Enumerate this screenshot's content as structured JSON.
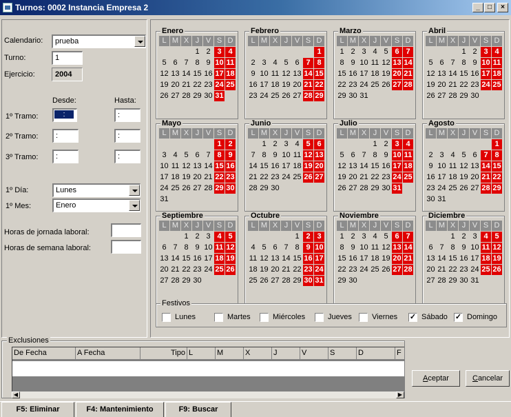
{
  "window": {
    "title": "Turnos: 0002 Instancia Empresa 2",
    "minimize": "_",
    "maximize": "□",
    "close": "×"
  },
  "form": {
    "calendario_label": "Calendario:",
    "calendario_value": "prueba",
    "turno_label": "Turno:",
    "turno_value": "1",
    "ejercicio_label": "Ejercicio:",
    "ejercicio_value": "2004",
    "desde_label": "Desde:",
    "hasta_label": "Hasta:",
    "tramo1_label": "1º Tramo:",
    "tramo2_label": "2º Tramo:",
    "tramo3_label": "3º Tramo:",
    "time_placeholder": ":",
    "primer_dia_label": "1º Día:",
    "primer_dia_value": "Lunes",
    "primer_mes_label": "1º Mes:",
    "primer_mes_value": "Enero",
    "horas_jornada_label": "Horas de jornada laboral:",
    "horas_semana_label": "Horas de semana laboral:"
  },
  "calendar": {
    "day_headers": [
      "L",
      "M",
      "X",
      "J",
      "V",
      "S",
      "D"
    ],
    "months": [
      {
        "name": "Enero",
        "offset": 3,
        "days": 31
      },
      {
        "name": "Febrero",
        "offset": 6,
        "days": 29
      },
      {
        "name": "Marzo",
        "offset": 0,
        "days": 31
      },
      {
        "name": "Abril",
        "offset": 3,
        "days": 30
      },
      {
        "name": "Mayo",
        "offset": 5,
        "days": 31
      },
      {
        "name": "Junio",
        "offset": 1,
        "days": 30
      },
      {
        "name": "Julio",
        "offset": 3,
        "days": 31
      },
      {
        "name": "Agosto",
        "offset": 6,
        "days": 31
      },
      {
        "name": "Septiembre",
        "offset": 2,
        "days": 30
      },
      {
        "name": "Octubre",
        "offset": 4,
        "days": 31
      },
      {
        "name": "Noviembre",
        "offset": 0,
        "days": 30
      },
      {
        "name": "Diciembre",
        "offset": 2,
        "days": 31
      }
    ],
    "weekend_color": "#e00000"
  },
  "festivos": {
    "title": "Festivos",
    "items": [
      {
        "label": "Lunes",
        "checked": false
      },
      {
        "label": "Martes",
        "checked": false
      },
      {
        "label": "Miércoles",
        "checked": false
      },
      {
        "label": "Jueves",
        "checked": false
      },
      {
        "label": "Viernes",
        "checked": false
      },
      {
        "label": "Sábado",
        "checked": true
      },
      {
        "label": "Domingo",
        "checked": true
      }
    ]
  },
  "exclusiones": {
    "title": "Exclusiones",
    "columns": [
      "De Fecha",
      "A Fecha",
      "Tipo",
      "L",
      "M",
      "X",
      "J",
      "V",
      "S",
      "D",
      "F"
    ]
  },
  "buttons": {
    "aceptar_pre": "",
    "aceptar_u": "A",
    "aceptar_rest": "ceptar",
    "cancelar_u": "C",
    "cancelar_rest": "ancelar"
  },
  "fkeys": [
    "F5: Eliminar",
    "F4: Mantenimiento",
    "F9: Buscar"
  ]
}
